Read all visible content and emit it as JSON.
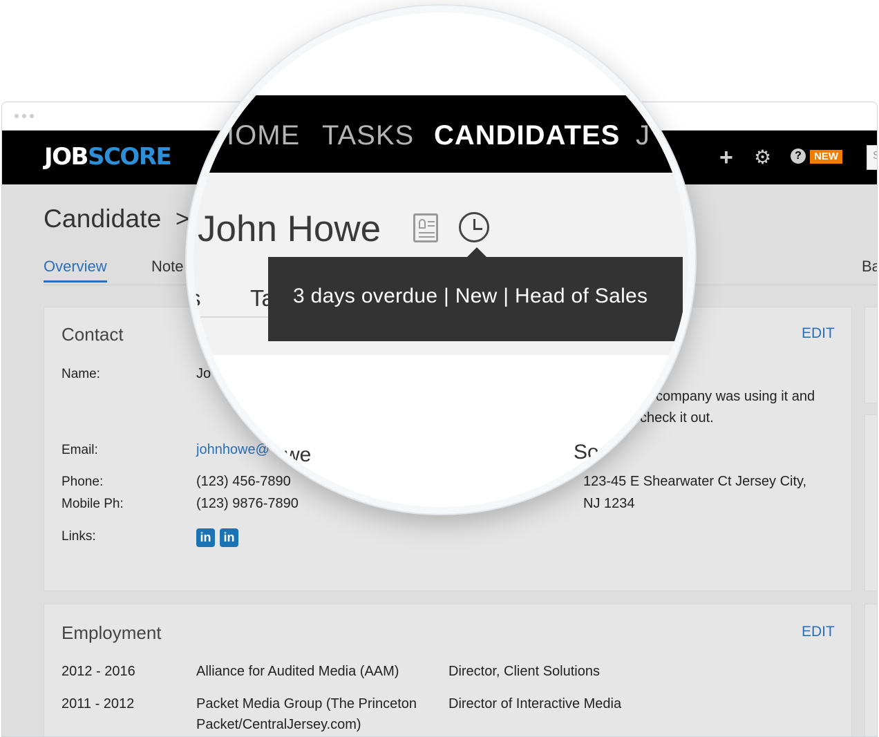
{
  "brand": {
    "logo_part1": "JOB",
    "logo_part2": "SCORE"
  },
  "navbar": {
    "new_badge": "NEW",
    "search_placeholder": "S"
  },
  "magnifier": {
    "nav_items": [
      "HOME",
      "TASKS",
      "CANDIDATES",
      "J"
    ],
    "nav_item_prefix_cut": "IOME",
    "candidate_name": "John Howe",
    "tooltip": "3 days overdue | New | Head of Sales",
    "tab_fragment_left": "s",
    "tab_fragment_right": "Ta",
    "email_fragment": "we",
    "side_fragment": "So"
  },
  "page": {
    "breadcrumb": "Candidate",
    "breadcrumb_sep": ">",
    "tabs": [
      "Overview",
      "Note",
      "Ba"
    ]
  },
  "contact": {
    "title": "Contact",
    "edit": "EDIT",
    "name_label": "Name:",
    "name_value": "Jo",
    "email_label": "Email:",
    "email_value": "johnhowe@",
    "phone_label": "Phone:",
    "phone_value": "(123) 456-7890",
    "mobile_label": "Mobile Ph:",
    "mobile_value": "(123) 9876-7890",
    "links_label": "Links:",
    "link_icons": [
      "in",
      "in"
    ],
    "note_line1": "company was using it and",
    "note_line2": "check it out.",
    "address_line1": "123-45 E Shearwater Ct Jersey City,",
    "address_line2": "NJ 1234"
  },
  "employment": {
    "title": "Employment",
    "edit": "EDIT",
    "rows": [
      {
        "years": "2012 - 2016",
        "company": "Alliance for Audited Media (AAM)",
        "role": "Director, Client Solutions"
      },
      {
        "years": "2011 - 2012",
        "company": "Packet Media Group (The Princeton",
        "company2": "Packet/CentralJersey.com)",
        "role": "Director of Interactive Media"
      }
    ]
  }
}
